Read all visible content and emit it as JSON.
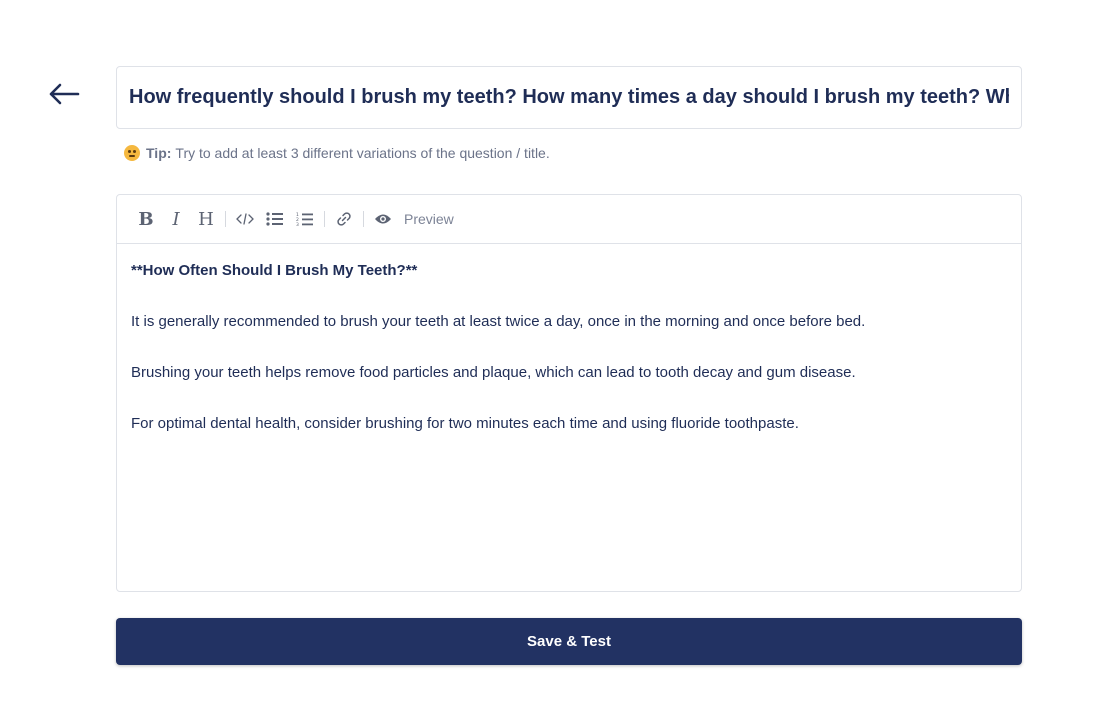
{
  "back": {
    "icon": "arrow-left-icon"
  },
  "title": {
    "value": "How frequently should I brush my teeth? How many times a day should I brush my teeth? What is the"
  },
  "tip": {
    "label": "Tip:",
    "text": "Try to add at least 3 different variations of the question / title.",
    "icon": "thinking-face-icon"
  },
  "toolbar": {
    "bold": "B",
    "italic": "I",
    "heading": "H",
    "preview_label": "Preview"
  },
  "editor": {
    "heading": "**How Often Should I Brush My Teeth?**",
    "paragraphs": [
      "It is generally recommended to brush your teeth at least twice a day, once in the morning and once before bed.",
      "Brushing your teeth helps remove food particles and plaque, which can lead to tooth decay and gum disease.",
      "For optimal dental health, consider brushing for two minutes each time and using fluoride toothpaste."
    ]
  },
  "save_button": {
    "label": "Save & Test"
  },
  "colors": {
    "primary": "#223263",
    "text": "#1f2d56",
    "muted": "#6b7389",
    "border": "#dfe2e8"
  }
}
